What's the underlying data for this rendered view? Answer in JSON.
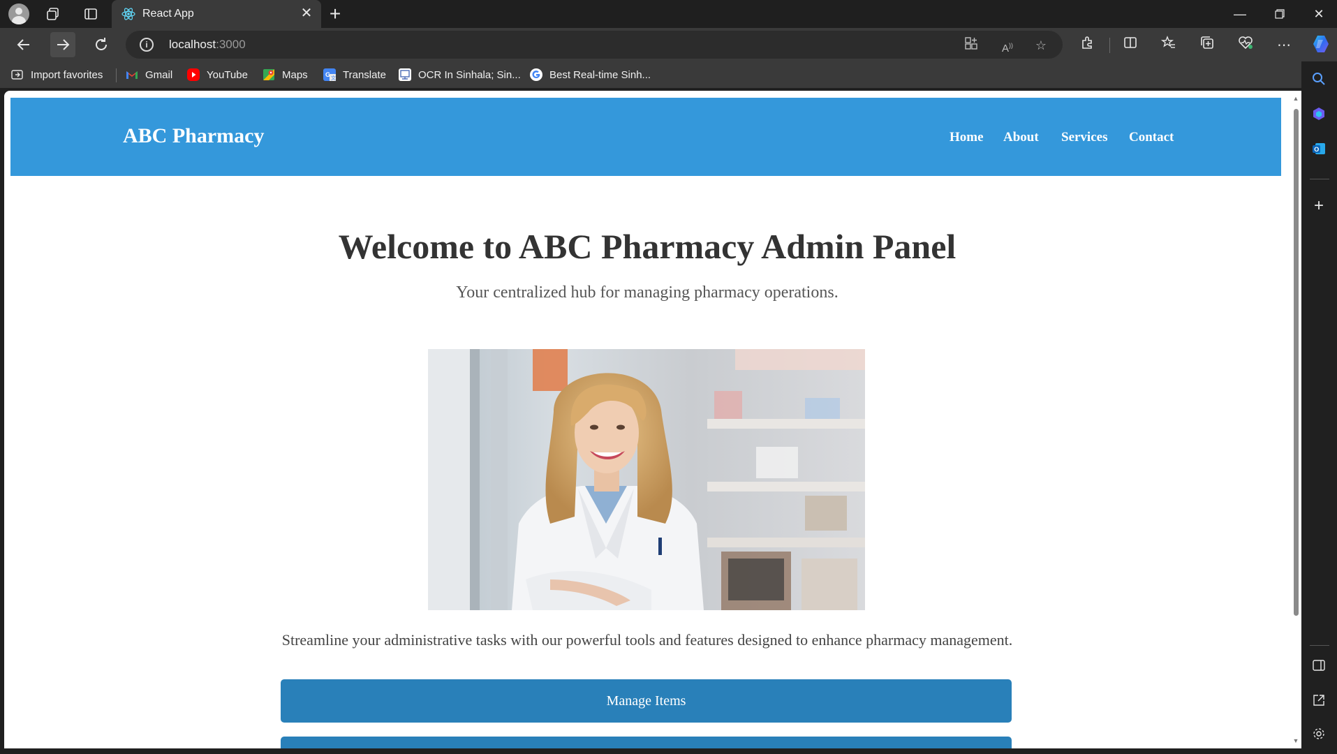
{
  "browser": {
    "tab_title": "React App",
    "url_host": "localhost",
    "url_port": ":3000",
    "favorites": [
      {
        "label": "Import favorites",
        "icon": "import-icon"
      },
      {
        "label": "Gmail",
        "icon": "gmail-icon"
      },
      {
        "label": "YouTube",
        "icon": "youtube-icon"
      },
      {
        "label": "Maps",
        "icon": "maps-icon"
      },
      {
        "label": "Translate",
        "icon": "translate-icon"
      },
      {
        "label": "OCR In Sinhala; Sin...",
        "icon": "ocr-icon"
      },
      {
        "label": "Best Real-time Sinh...",
        "icon": "google-icon"
      }
    ]
  },
  "site": {
    "brand": "ABC Pharmacy",
    "nav": [
      "Home",
      "About",
      "Services",
      "Contact"
    ],
    "hero_title": "Welcome to ABC Pharmacy Admin Panel",
    "hero_subtitle": "Your centralized hub for managing pharmacy operations.",
    "description": "Streamline your administrative tasks with our powerful tools and features designed to enhance pharmacy management.",
    "buttons": [
      "Manage Items"
    ]
  },
  "colors": {
    "header_bg": "#3498db",
    "button_bg": "#2980b9",
    "browser_chrome": "#3a3a3a"
  }
}
